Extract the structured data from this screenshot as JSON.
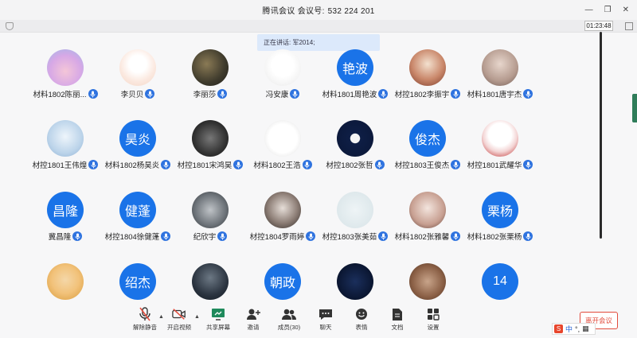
{
  "window": {
    "title": "腾讯会议",
    "meeting_label": "会议号:",
    "meeting_id": "532 224 201"
  },
  "timer": "01:23:48",
  "speaking_banner": "正在讲话: 军2014;",
  "colors": {
    "avatar_blue": "#1a73e8",
    "mic_blue": "#2f73df",
    "leave_red": "#e24b3c"
  },
  "participants": [
    {
      "name": "材料1802陈丽...",
      "avatar_text": "",
      "photo": "pink"
    },
    {
      "name": "李贝贝",
      "avatar_text": "",
      "photo": "deer"
    },
    {
      "name": "李丽莎",
      "avatar_text": "",
      "photo": "dark"
    },
    {
      "name": "冯安康",
      "avatar_text": "",
      "photo": "sketch"
    },
    {
      "name": "材料1801周艳波",
      "avatar_text": "艳波",
      "photo": ""
    },
    {
      "name": "材控1802李振宇",
      "avatar_text": "",
      "photo": "art"
    },
    {
      "name": "材料1801唐宇杰",
      "avatar_text": "",
      "photo": "face"
    },
    {
      "name": "材控1801王伟煌",
      "avatar_text": "",
      "photo": "anime"
    },
    {
      "name": "材料1802杨昊炎",
      "avatar_text": "昊炎",
      "photo": ""
    },
    {
      "name": "材控1801宋鸿昊",
      "avatar_text": "",
      "photo": "bw"
    },
    {
      "name": "材料1802王浩",
      "avatar_text": "",
      "photo": "cube"
    },
    {
      "name": "材控1802张哲",
      "avatar_text": "",
      "photo": "navy"
    },
    {
      "name": "材控1803王俊杰",
      "avatar_text": "俊杰",
      "photo": ""
    },
    {
      "name": "材控1801武耀华",
      "avatar_text": "",
      "photo": "gun"
    },
    {
      "name": "冀昌隆",
      "avatar_text": "昌隆",
      "photo": ""
    },
    {
      "name": "材控1804徐健蓬",
      "avatar_text": "健蓬",
      "photo": ""
    },
    {
      "name": "纪欣宇",
      "avatar_text": "",
      "photo": "gray"
    },
    {
      "name": "材控1804罗雨婷",
      "avatar_text": "",
      "photo": "boy"
    },
    {
      "name": "材控1803张美茹",
      "avatar_text": "",
      "photo": "light"
    },
    {
      "name": "材料1802张雅馨",
      "avatar_text": "",
      "photo": "girl"
    },
    {
      "name": "材料1802张栗杨",
      "avatar_text": "栗杨",
      "photo": ""
    },
    {
      "name": "",
      "avatar_text": "",
      "photo": "cartoon"
    },
    {
      "name": "",
      "avatar_text": "绍杰",
      "photo": ""
    },
    {
      "name": "",
      "avatar_text": "",
      "photo": "night"
    },
    {
      "name": "",
      "avatar_text": "朝政",
      "photo": ""
    },
    {
      "name": "",
      "avatar_text": "",
      "photo": "space"
    },
    {
      "name": "",
      "avatar_text": "",
      "photo": "dog"
    },
    {
      "name": "",
      "avatar_text": "14",
      "photo": ""
    }
  ],
  "toolbar": {
    "mute": "解除静音",
    "video": "开启视频",
    "share": "共享屏幕",
    "invite": "邀请",
    "members": "成员(30)",
    "chat": "聊天",
    "emoji": "表情",
    "docs": "文档",
    "settings": "设置",
    "leave": "离开会议"
  },
  "ime": {
    "lang": "中"
  }
}
